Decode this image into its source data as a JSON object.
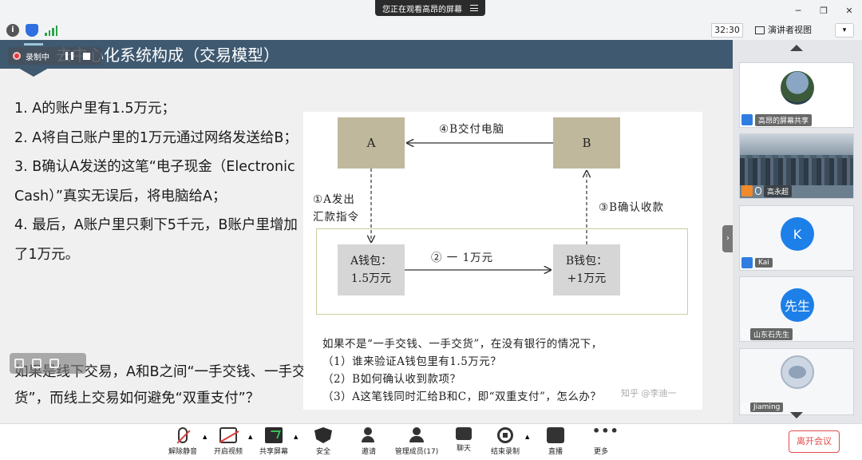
{
  "banner": {
    "text": "您正在观看高昂的屏幕"
  },
  "toolbar": {
    "timer": "32:30",
    "view_mode": "演讲者视图"
  },
  "recording": {
    "label": "录制中"
  },
  "slide": {
    "title": "去中心化系统构成（交易模型）",
    "points": [
      "1. A的账户里有1.5万元；",
      "2. A将自己账户里的1万元通过网络发送给B；",
      "3. B确认A发送的这笔“电子现金（Electronic Cash）”真实无误后，将电脑给A；",
      "4. 最后，A账户里只剩下5千元，B账户里增加了1万元。"
    ],
    "bottom_text": "如果是线下交易，A和B之间“一手交钱、一手交货”，而线上交易如何避免“双重支付”？",
    "diagram": {
      "node_a": "A",
      "node_b": "B",
      "step4": "④B交付电脑",
      "step1_line1": "①A发出",
      "step1_line2": "汇款指令",
      "step3": "③B确认收款",
      "step2": "② 一 1万元",
      "wallet_a_line1": "A钱包：",
      "wallet_a_line2": "1.5万元",
      "wallet_b_line1": "B钱包：",
      "wallet_b_line2": "+1万元",
      "q_intro": "如果不是“一手交钱、一手交货”，在没有银行的情况下，",
      "q1": "（1）谁来验证A钱包里有1.5万元？",
      "q2": "（2）B如何确认收到款项？",
      "q3": "（3）A这笔钱同时汇给B和C，即“双重支付”，怎么办？",
      "watermark": "知乎 @李迪一"
    }
  },
  "participants": [
    {
      "name": "高昂的屏幕共享",
      "type": "screen"
    },
    {
      "name": "高永超",
      "type": "video"
    },
    {
      "name": "Kai",
      "avatar_letter": "K"
    },
    {
      "name": "山东石先生",
      "avatar_letter": "先生"
    },
    {
      "name": "Jiaming",
      "type": "avatar"
    }
  ],
  "bottombar": {
    "unmute": "解除静音",
    "start_video": "开启视频",
    "share_screen": "共享屏幕",
    "security": "安全",
    "invite": "邀请",
    "manage_members": "管理成员(17)",
    "chat": "聊天",
    "end_recording": "结束录制",
    "live": "直播",
    "more": "更多",
    "leave": "离开会议"
  }
}
